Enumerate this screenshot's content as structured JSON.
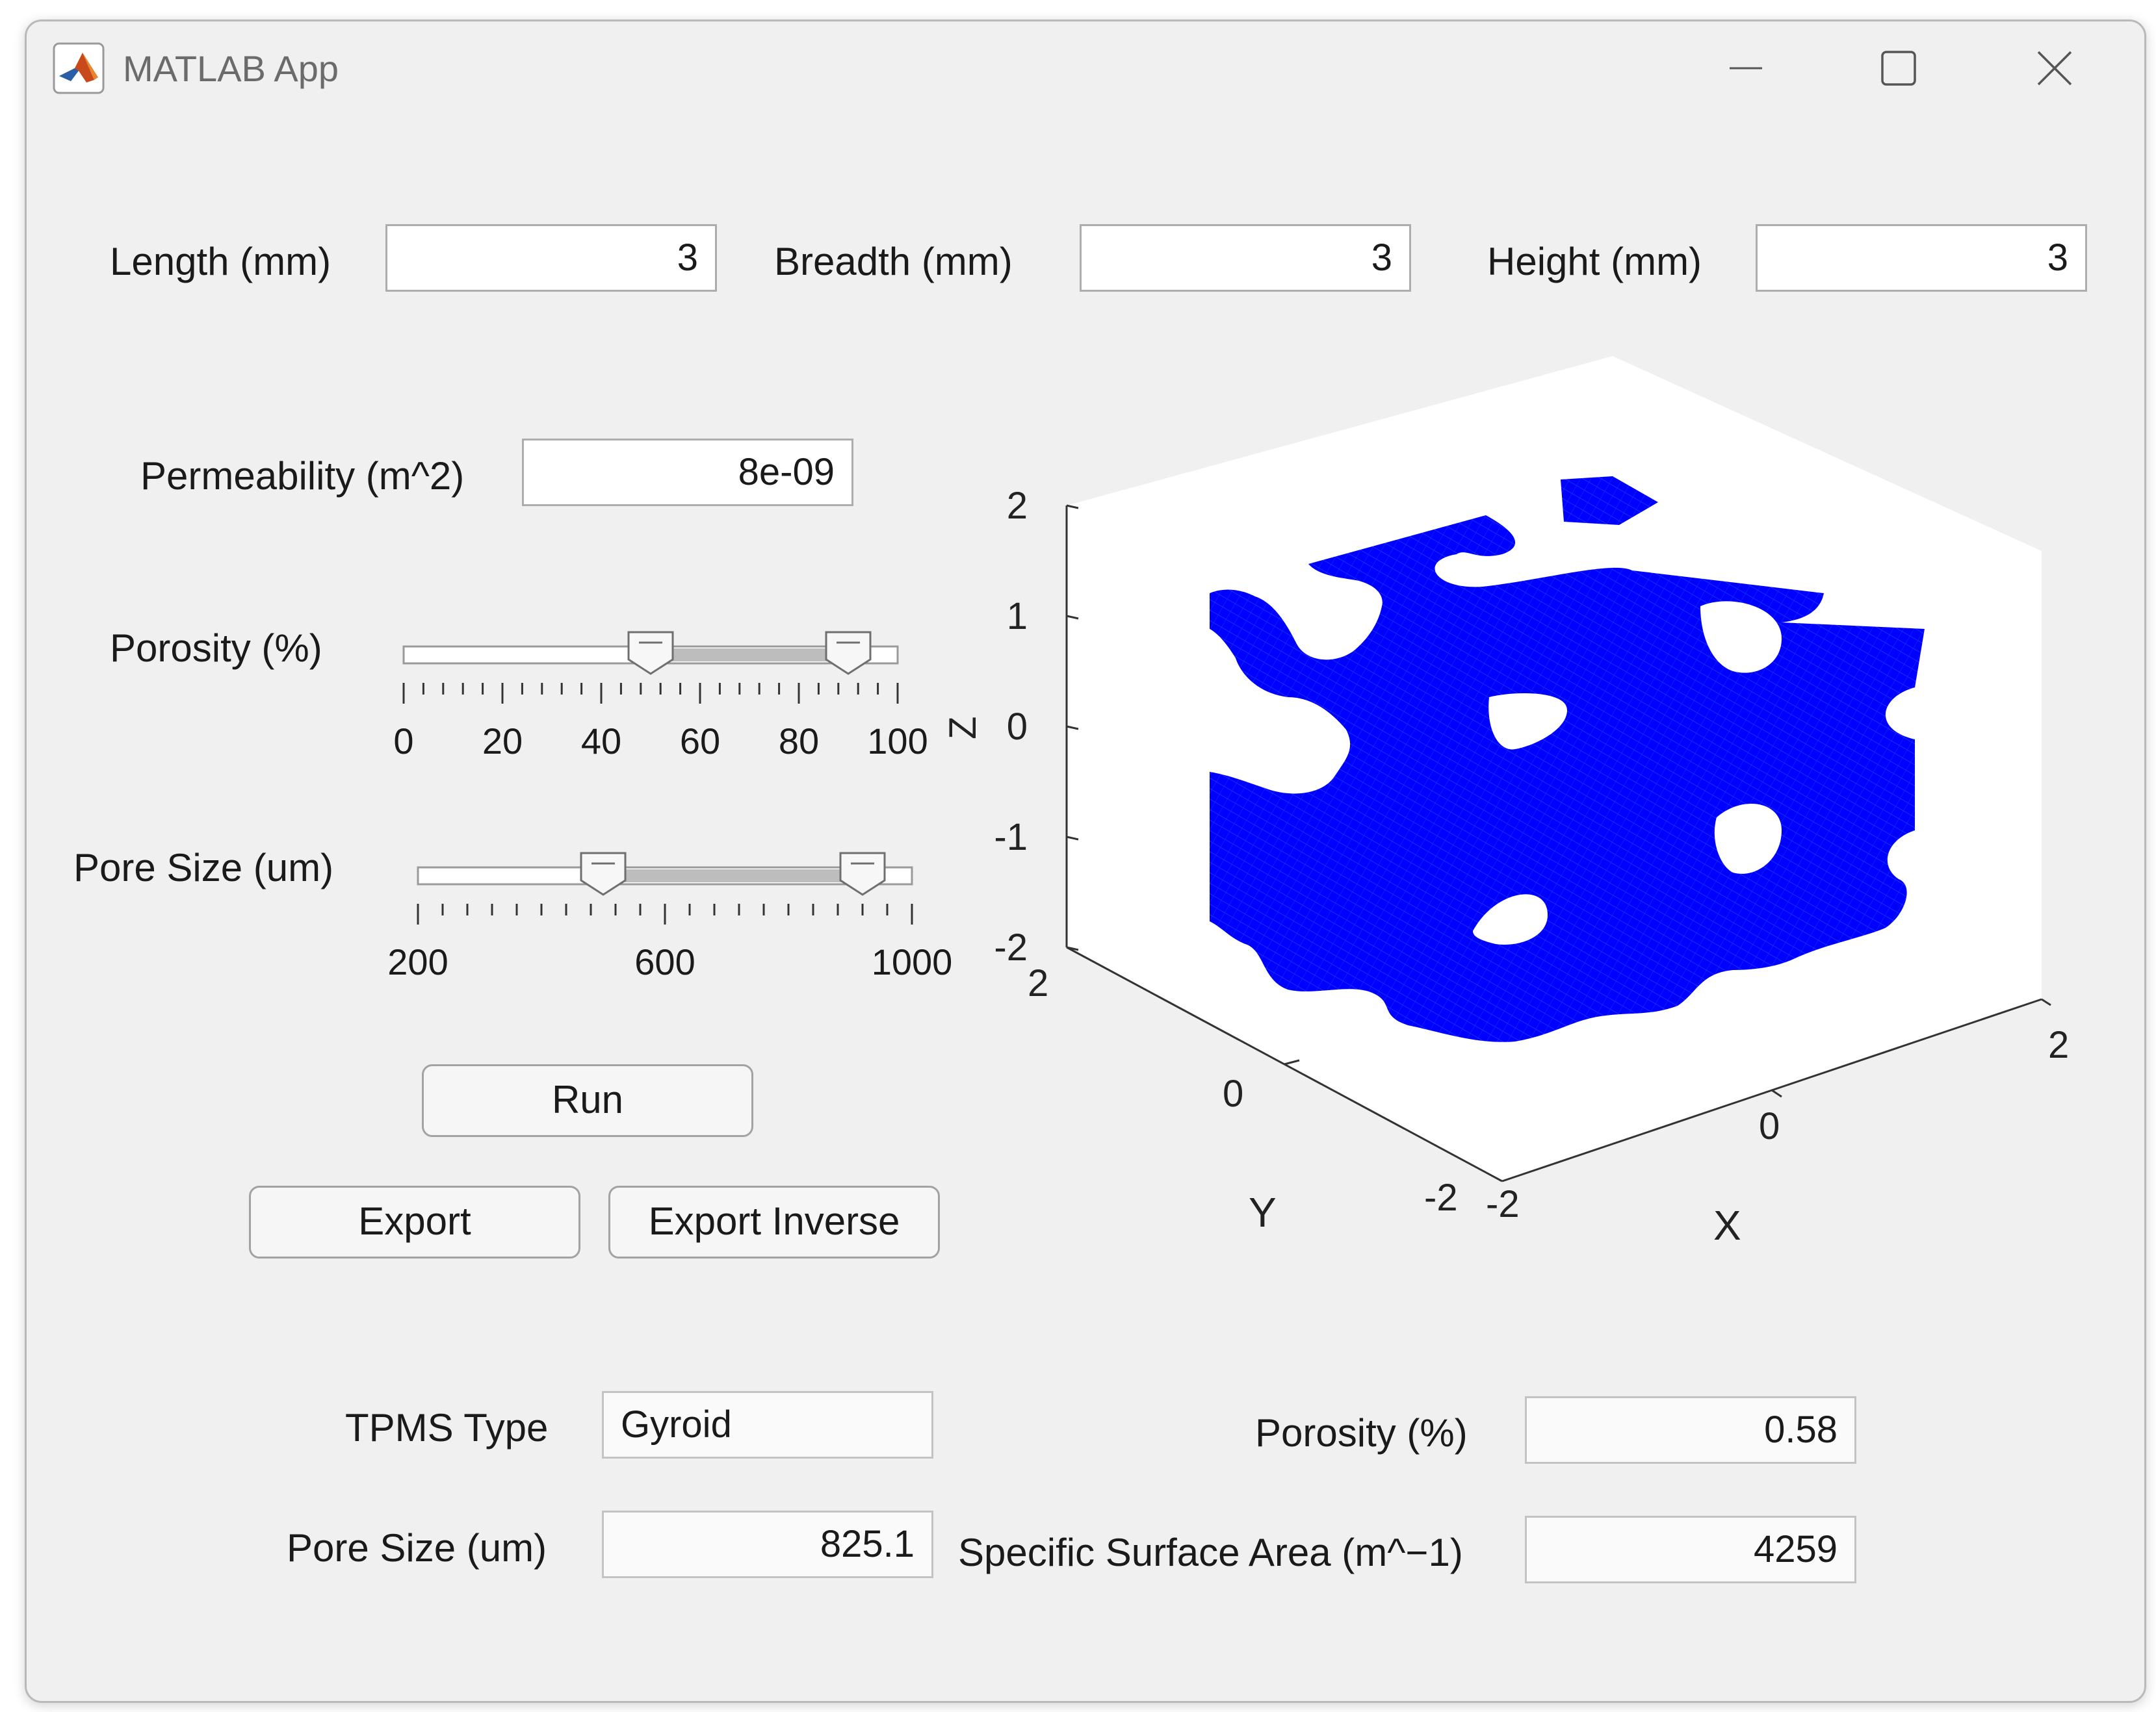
{
  "window": {
    "title": "MATLAB App"
  },
  "inputs": {
    "length_label": "Length (mm)",
    "length_value": "3",
    "breadth_label": "Breadth  (mm)",
    "breadth_value": "3",
    "height_label": "Height (mm)",
    "height_value": "3",
    "permeability_label": "Permeability (m^2)",
    "permeability_value": "8e-09"
  },
  "porosity_slider": {
    "label": "Porosity (%)",
    "min": 0,
    "max": 100,
    "tick_labels": [
      "0",
      "20",
      "40",
      "60",
      "80",
      "100"
    ],
    "low_value": 50,
    "high_value": 90
  },
  "pore_slider": {
    "label": "Pore Size (um)",
    "min": 200,
    "max": 1000,
    "tick_labels": [
      "200",
      "600",
      "1000"
    ],
    "low_value": 500,
    "high_value": 920
  },
  "buttons": {
    "run": "Run",
    "export": "Export",
    "export_inverse": "Export Inverse"
  },
  "results": {
    "tpms_type_label": "TPMS Type",
    "tpms_type_value": "Gyroid",
    "pore_size_label": "Pore Size (um)",
    "pore_size_value": "825.1",
    "porosity_label": "Porosity (%)",
    "porosity_value": "0.58",
    "ssa_label": "Specific Surface Area (m^−1)",
    "ssa_value": "4259"
  },
  "plot3d": {
    "surface_color": "#0000ff",
    "z_ticks": [
      "2",
      "1",
      "0",
      "-1",
      "-2"
    ],
    "z_label": "Z",
    "y_ticks": [
      "2",
      "0",
      "-2"
    ],
    "y_label": "Y",
    "x_ticks": [
      "-2",
      "0",
      "2"
    ],
    "x_label": "X"
  }
}
